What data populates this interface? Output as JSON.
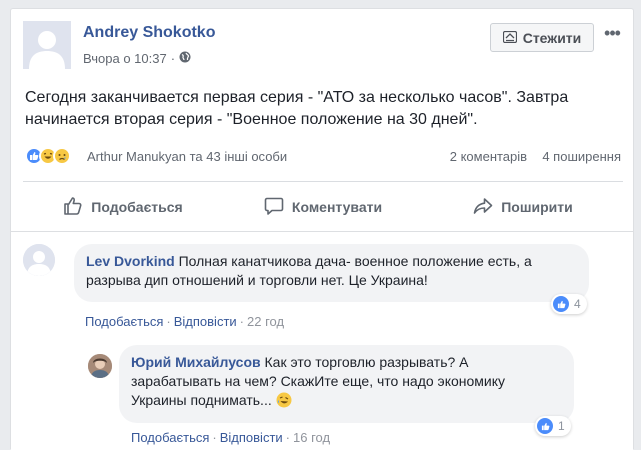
{
  "post": {
    "author": "Andrey Shokotko",
    "time": "Вчора о 10:37",
    "separator": "·",
    "follow_label": "Стежити",
    "more_label": "•••",
    "text": "Сегодня заканчивается первая серия - \"АТО за несколько часов\". Завтра начинается вторая серия - \"Военное положение на 30 дней\".",
    "reactions_text": "Arthur Manukyan та 43 інші особи",
    "comments_count": "2 коментарів",
    "shares_count": "4 поширення"
  },
  "actions": {
    "like": "Подобається",
    "comment": "Коментувати",
    "share": "Поширити"
  },
  "comments": [
    {
      "author": "Lev Dvorkind",
      "text": "Полная канатчикова дача- военное положение есть, а разрыва дип отношений и торговли нет. Це Украина!",
      "like_label": "Подобається",
      "reply_label": "Відповісти",
      "time": "22 год",
      "reaction_count": "4"
    },
    {
      "author": "Юрий Михайлусов",
      "text": "Как это торговлю разрывать? А зарабатывать на чем? СкажИте еще, что надо экономику Украины поднимать...",
      "like_label": "Подобається",
      "reply_label": "Відповісти",
      "time": "16 год",
      "reaction_count": "1"
    }
  ],
  "colors": {
    "link": "#385898",
    "secondary": "#616770",
    "like_blue": "#4b8cfb",
    "emoji_yellow": "#f7c844"
  }
}
